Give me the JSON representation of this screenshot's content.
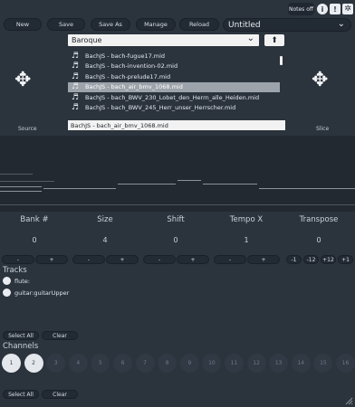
{
  "toolbar": {
    "new_label": "New",
    "save_label": "Save",
    "saveas_label": "Save As",
    "manage_label": "Manage",
    "reload_label": "Reload",
    "project_title": "Untitled",
    "notes_off_label": "Notes off",
    "info_icon": "info-icon",
    "warn_icon": "exclamation-icon",
    "settings_icon": "gear-icon"
  },
  "browser": {
    "genre": "Baroque",
    "files": [
      "BachJS - bach-fugue17.mid",
      "BachJS - bach-invention-02.mid",
      "BachJS - bach-prelude17.mid",
      "BachJS - bach_air_bmv_1068.mid",
      "BachJS - bach_BWV_230_Lobet_den_Herrn_alle_Heiden.mid",
      "BachJS - bach_BWV_245_Herr_unser_Herrscher.mid"
    ],
    "selected_index": 3,
    "selected_file": "BachJS - bach_air_bmv_1068.mid",
    "source_label": "Source",
    "slice_label": "Slice"
  },
  "params": [
    {
      "label": "Bank #",
      "value": "0",
      "buttons": [
        "-",
        "+"
      ]
    },
    {
      "label": "Size",
      "value": "4",
      "buttons": [
        "-",
        "+"
      ]
    },
    {
      "label": "Shift",
      "value": "0",
      "buttons": [
        "-",
        "+"
      ]
    },
    {
      "label": "Tempo X",
      "value": "1",
      "buttons": [
        "-",
        "+"
      ]
    },
    {
      "label": "Transpose",
      "value": "0",
      "buttons": [
        "-1",
        "-12",
        "+12",
        "+1"
      ]
    }
  ],
  "tracks": {
    "title": "Tracks",
    "items": [
      "flute:",
      "guitar:guitarUpper"
    ],
    "select_all": "Select All",
    "clear": "Clear"
  },
  "channels": {
    "title": "Channels",
    "items": [
      "1",
      "2",
      "3",
      "4",
      "5",
      "6",
      "7",
      "8",
      "9",
      "10",
      "11",
      "12",
      "13",
      "14",
      "15",
      "16"
    ],
    "active": [
      0,
      1
    ],
    "select_all": "Select All",
    "clear": "Clear"
  },
  "colors": {
    "background": "#2b333d",
    "timeline": "#222930",
    "selected_row": "#9da3aa"
  }
}
